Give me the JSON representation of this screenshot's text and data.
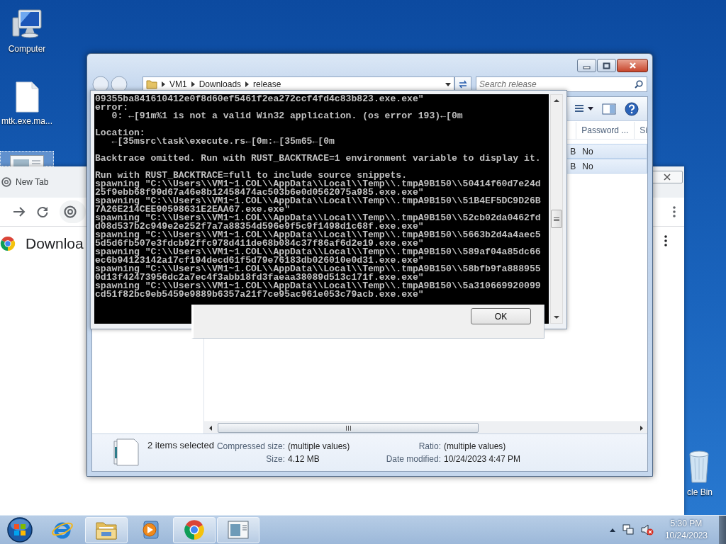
{
  "desktop_icons": [
    {
      "label": "Computer",
      "kind": "computer",
      "selected": false
    },
    {
      "label": "mtk.exe.ma...",
      "kind": "file",
      "selected": false
    },
    {
      "kind": "app",
      "selected": true
    },
    {
      "label": "cle Bin",
      "kind": "recycle",
      "selected": false
    }
  ],
  "browser": {
    "tab": "New Tab",
    "heading": "Downloa"
  },
  "explorer": {
    "breadcrumb": [
      "VM1",
      "Downloads",
      "release"
    ],
    "search": {
      "placeholder": "Search release"
    },
    "columns": [
      "",
      "Password ...",
      "Si"
    ],
    "rows": [
      {
        "cells": [
          "B",
          "No"
        ],
        "selected": true
      },
      {
        "cells": [
          "B",
          "No"
        ],
        "selected": true
      }
    ],
    "details": {
      "selection": "2 items selected",
      "fields": [
        {
          "label": "Compressed size:",
          "value": "(multiple values)"
        },
        {
          "label": "Size:",
          "value": "4.12 MB"
        },
        {
          "label": "Ratio:",
          "value": "(multiple values)"
        },
        {
          "label": "Date modified:",
          "value": "10/24/2023 4:47 PM"
        }
      ]
    }
  },
  "console": {
    "blocks": [
      [
        "09355ba841610412e0f8d60ef5461f2ea272ccf4fd4c83b823.exe.exe\"",
        "error:",
        "   0: ←[91m%1 is not a valid Win32 application. (os error 193)←[0m"
      ],
      [
        "Location:",
        "   ←[35msrc\\task\\execute.rs←[0m:←[35m65←[0m"
      ],
      [
        "Backtrace omitted. Run with RUST_BACKTRACE=1 environment variable to display it."
      ],
      [
        "Run with RUST_BACKTRACE=full to include source snippets.",
        "spawning \"C:\\\\Users\\\\VM1~1.COL\\\\AppData\\\\Local\\\\Temp\\\\.tmpA9B150\\\\50414f60d7e24d",
        "25f9ebb68f99d67a46e8b12458474ac503b6e0d0562075a985.exe.exe\"",
        "spawning \"C:\\\\Users\\\\VM1~1.COL\\\\AppData\\\\Local\\\\Temp\\\\.tmpA9B150\\\\51B4EF5DC9D26B",
        "7A26E214CEE90598631E2EAA67.exe.exe\"",
        "spawning \"C:\\\\Users\\\\VM1~1.COL\\\\AppData\\\\Local\\\\Temp\\\\.tmpA9B150\\\\52cb02da0462fd",
        "d08d537b2c949e2e252f7a7a88354d596e9f5c9f1498d1c68f.exe.exe\"",
        "spawning \"C:\\\\Users\\\\VM1~1.COL\\\\AppData\\\\Local\\\\Temp\\\\.tmpA9B150\\\\5663b2d4a4aec5",
        "5d5d6fb507e3fdcb92ffc978d411de68b084c37f86af6d2e19.exe.exe\"",
        "spawning \"C:\\\\Users\\\\VM1~1.COL\\\\AppData\\\\Local\\\\Temp\\\\.tmpA9B150\\\\589af04a85dc66",
        "ec6b94123142a17cf194decd61f5d79e76183db026010e0d31.exe.exe\"",
        "spawning \"C:\\\\Users\\\\VM1~1.COL\\\\AppData\\\\Local\\\\Temp\\\\.tmpA9B150\\\\58bfb9fa888955",
        "0d13f42473956dc2a7ec4f3abb18fd3faeaa38089d513c171f.exe.exe\"",
        "spawning \"C:\\\\Users\\\\VM1~1.COL\\\\AppData\\\\Local\\\\Temp\\\\.tmpA9B150\\\\5a310669920099",
        "cd51f82bc9eb5459e9889b6357a21f7ce95ac961e053c79acb.exe.exe\""
      ]
    ]
  },
  "dialog": {
    "button": "OK"
  },
  "taskbar": {
    "items": [
      {
        "kind": "start",
        "open": false
      },
      {
        "kind": "ie",
        "open": false
      },
      {
        "kind": "folder",
        "open": true
      },
      {
        "kind": "media",
        "open": false
      },
      {
        "kind": "chrome",
        "open": true
      },
      {
        "kind": "console",
        "open": true
      }
    ],
    "clock": {
      "time": "5:30 PM",
      "date": "10/24/2023"
    }
  }
}
